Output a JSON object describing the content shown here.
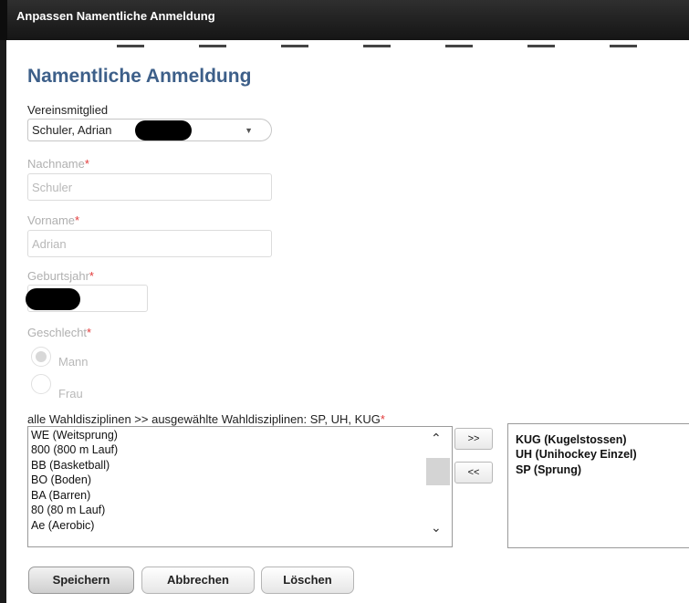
{
  "window": {
    "title": "Anpassen Namentliche Anmeldung"
  },
  "form": {
    "heading": "Namentliche Anmeldung",
    "member": {
      "label": "Vereinsmitglied",
      "value": "Schuler, Adrian"
    },
    "lastname": {
      "label": "Nachname",
      "required_mark": "*",
      "value": "Schuler"
    },
    "firstname": {
      "label": "Vorname",
      "required_mark": "*",
      "value": "Adrian"
    },
    "birthyear": {
      "label": "Geburtsjahr",
      "required_mark": "*",
      "value": ""
    },
    "gender": {
      "label": "Geschlecht",
      "required_mark": "*",
      "options": [
        "Mann",
        "Frau"
      ],
      "selected": "Mann"
    },
    "disciplines": {
      "label": "alle Wahldisziplinen >> ausgewählte Wahldisziplinen: SP, UH, KUG",
      "required_mark": "*",
      "available": [
        "WE (Weitsprung)",
        "800 (800 m Lauf)",
        "BB (Basketball)",
        "BO (Boden)",
        "BA (Barren)",
        "80 (80 m Lauf)",
        "Ae (Aerobic)"
      ],
      "selected": [
        "KUG (Kugelstossen)",
        "UH (Unihockey Einzel)",
        "SP (Sprung)"
      ],
      "add_label": ">>",
      "remove_label": "<<"
    }
  },
  "buttons": {
    "save": "Speichern",
    "cancel": "Abbrechen",
    "delete": "Löschen"
  }
}
